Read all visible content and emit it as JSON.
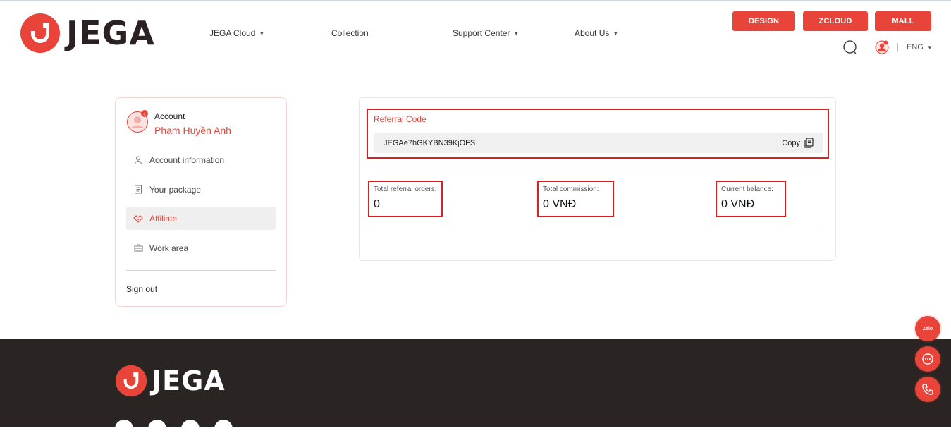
{
  "brand": {
    "name": "JEGA",
    "accent": "#e8443a",
    "dark": "#2b2122"
  },
  "nav": [
    {
      "label": "JEGA Cloud",
      "has_dropdown": true
    },
    {
      "label": "Collection",
      "has_dropdown": false
    },
    {
      "label": "Support Center",
      "has_dropdown": true
    },
    {
      "label": "About Us",
      "has_dropdown": true
    }
  ],
  "top_buttons": {
    "design": "DESIGN",
    "zcloud": "ZCLOUD",
    "mall": "MALL"
  },
  "utility": {
    "language": "ENG",
    "search_icon": "search-icon",
    "avatar_icon": "user-avatar-icon"
  },
  "sidebar": {
    "account_label": "Account",
    "user_name": "Phạm Huyền Anh",
    "items": [
      {
        "label": "Account information",
        "icon": "person-icon"
      },
      {
        "label": "Your package",
        "icon": "document-icon"
      },
      {
        "label": "Affiliate",
        "icon": "handshake-icon",
        "active": true
      },
      {
        "label": "Work area",
        "icon": "briefcase-icon"
      }
    ],
    "sign_out": "Sign out"
  },
  "referral": {
    "title": "Referral Code",
    "code": "JEGAe7hGKYBN39KjOFS",
    "copy_label": "Copy"
  },
  "stats": {
    "orders": {
      "label": "Total referral orders:",
      "value": "0"
    },
    "commission": {
      "label": "Total commission:",
      "value": "0 VNĐ"
    },
    "balance": {
      "label": "Current balance:",
      "value": "0 VNĐ"
    }
  },
  "footer": {
    "brand": "JEGA"
  },
  "floating": {
    "zalo_label": "Zalo"
  }
}
